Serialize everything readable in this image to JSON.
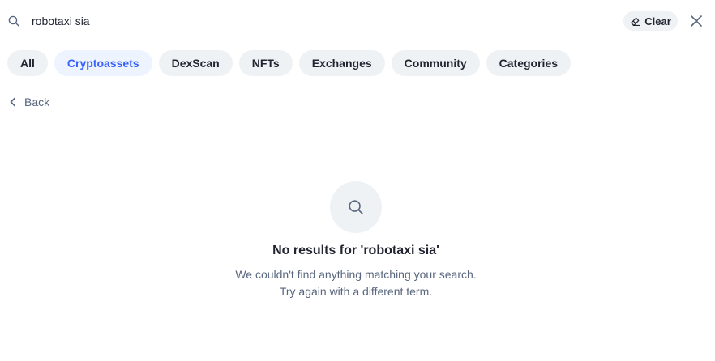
{
  "search": {
    "value": "robotaxi sia",
    "clear_label": "Clear"
  },
  "tabs": [
    {
      "label": "All",
      "active": false
    },
    {
      "label": "Cryptoassets",
      "active": true
    },
    {
      "label": "DexScan",
      "active": false
    },
    {
      "label": "NFTs",
      "active": false
    },
    {
      "label": "Exchanges",
      "active": false
    },
    {
      "label": "Community",
      "active": false
    },
    {
      "label": "Categories",
      "active": false
    }
  ],
  "back": {
    "label": "Back"
  },
  "empty_state": {
    "title": "No results for 'robotaxi sia'",
    "line1": "We couldn't find anything matching your search.",
    "line2": "Try again with a different term."
  },
  "colors": {
    "accent": "#3861fb",
    "accent_bg": "#eef4ff",
    "chip_bg": "#eff2f5",
    "text": "#222531",
    "muted": "#58667e"
  },
  "icons": {
    "search": "search-icon",
    "clear": "eraser-icon",
    "close": "close-icon",
    "back": "chevron-left-icon",
    "empty": "search-icon"
  }
}
